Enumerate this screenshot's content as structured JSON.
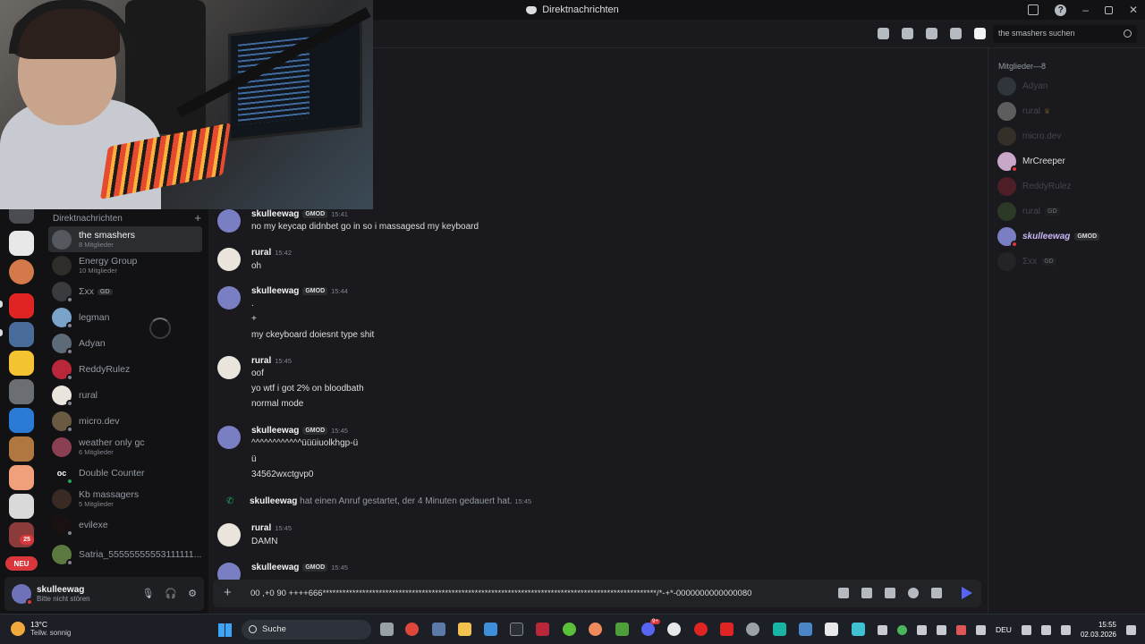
{
  "window": {
    "title": "Direktnachrichten"
  },
  "dm_list": {
    "header": "Direktnachrichten",
    "items": [
      {
        "name": "the smashers",
        "sub": "8 Mitglieder"
      },
      {
        "name": "Energy Group",
        "sub": "10 Mitglieder"
      },
      {
        "name": "Σxx",
        "tag": "GD"
      },
      {
        "name": "legman"
      },
      {
        "name": "Adyan"
      },
      {
        "name": "ReddyRulez"
      },
      {
        "name": "rural"
      },
      {
        "name": "micro.dev"
      },
      {
        "name": "weather only gc",
        "sub": "6 Mitglieder"
      },
      {
        "name": "Double Counter"
      },
      {
        "name": "Kb massagers",
        "sub": "5 Mitglieder"
      },
      {
        "name": "evilexe"
      },
      {
        "name": "Satria_55555555553111111..."
      }
    ]
  },
  "server_bar": {
    "badge": "25",
    "new_label": "NEU"
  },
  "user_panel": {
    "name": "skulleewag",
    "status": "Bitte nicht stören"
  },
  "header": {
    "search_placeholder": "the smashers suchen"
  },
  "messages": [
    {
      "author": "skulleewag",
      "tag": "GMOD",
      "time": "15:41",
      "lines": [
        "no my keycap didnbet go in so i massagesd my keyboard"
      ]
    },
    {
      "author": "rural",
      "time": "15:42",
      "lines": [
        "oh"
      ]
    },
    {
      "author": "skulleewag",
      "tag": "GMOD",
      "time": "15:44",
      "lines": [
        ".",
        "+",
        "my ckeyboard doiesnt type shit"
      ]
    },
    {
      "author": "rural",
      "time": "15:45",
      "lines": [
        "oof",
        "yo wtf i got 2% on bloodbath",
        "normal mode"
      ]
    },
    {
      "author": "skulleewag",
      "tag": "GMOD",
      "time": "15:45",
      "lines": [
        "^^^^^^^^^^^^üüüiuolkhgp-ü",
        "ü",
        "34562wxctgvp0"
      ]
    },
    {
      "author": "rural",
      "time": "15:45",
      "lines": [
        "DAMN"
      ]
    },
    {
      "author": "skulleewag",
      "tag": "GMOD",
      "time": "15:45",
      "lines": []
    }
  ],
  "call_event": {
    "who": "skulleewag",
    "text": "hat einen Anruf gestartet, der 4 Minuten gedauert hat.",
    "time": "15:45"
  },
  "composer": {
    "text": "00 ,+0 90 ++++666*****************************************************************************************************/*-+*-0000000000000080"
  },
  "members": {
    "header": "Mitglieder—8",
    "items": [
      {
        "name": "Adyan"
      },
      {
        "name": "rural"
      },
      {
        "name": "micro.dev"
      },
      {
        "name": "MrCreeper"
      },
      {
        "name": "ReddyRulez"
      },
      {
        "name": "rural",
        "tag": "GD"
      },
      {
        "name": "skulleewag",
        "tag": "GMOD"
      },
      {
        "name": "Σxx",
        "tag": "GD"
      }
    ]
  },
  "taskbar": {
    "weather_temp": "13°C",
    "weather_desc": "Teilw. sonnig",
    "search": "Suche",
    "discord_badge": "9+",
    "lang": "DEU",
    "time": "15:55",
    "date": "02.03.2026"
  }
}
